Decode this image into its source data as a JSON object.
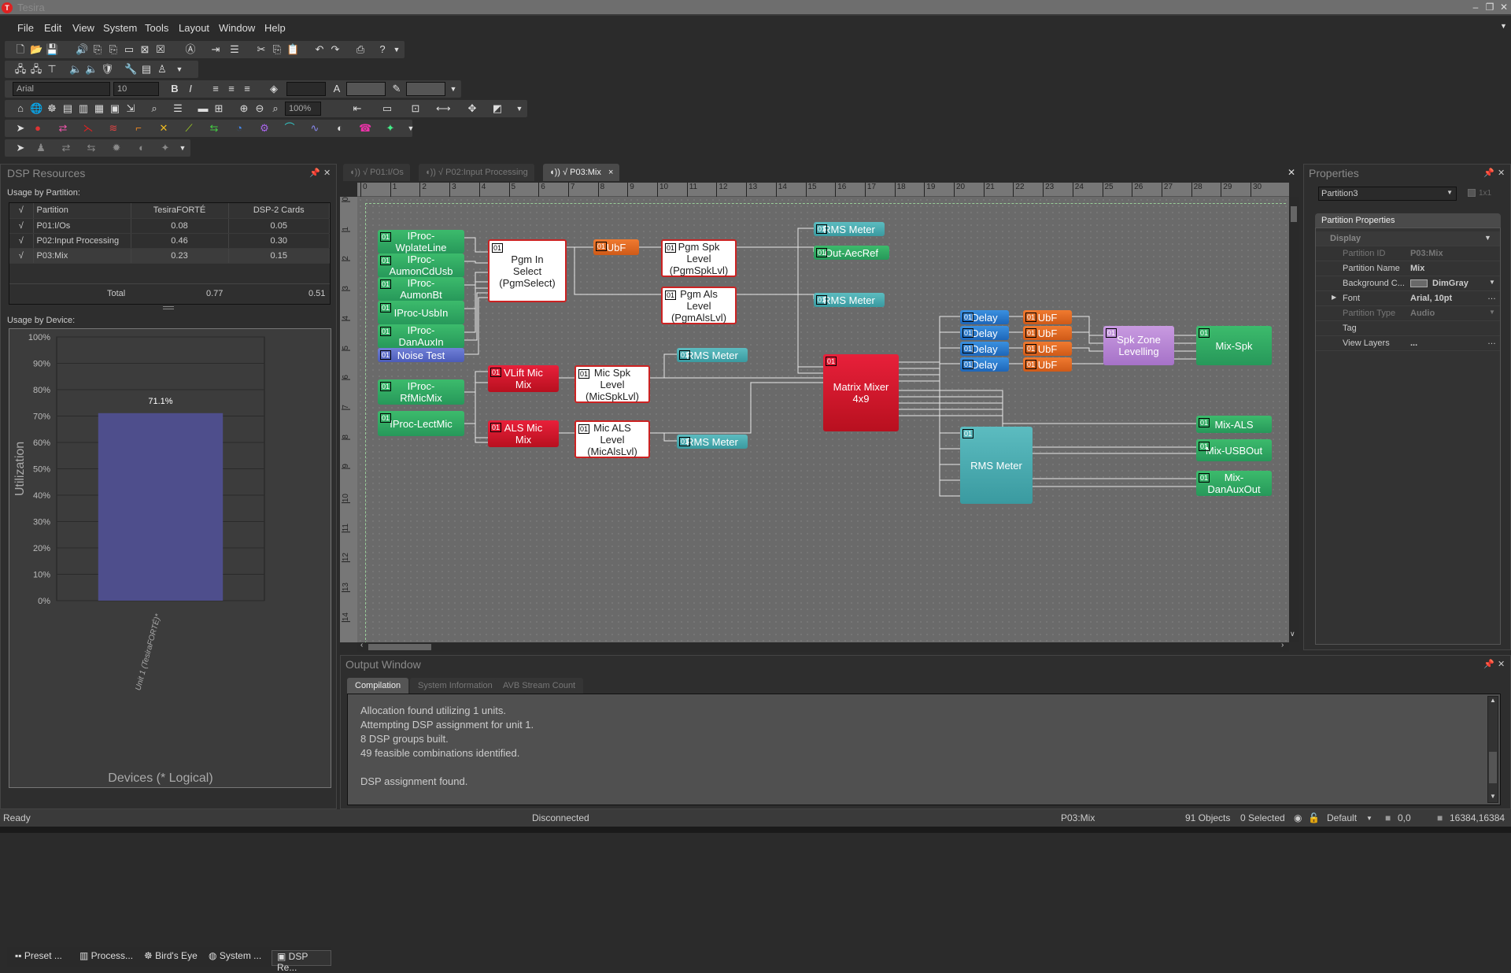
{
  "window": {
    "title": "Tesira",
    "logo": "T"
  },
  "menu": [
    "File",
    "Edit",
    "View",
    "System",
    "Tools",
    "Layout",
    "Window",
    "Help"
  ],
  "toolbar": {
    "font_name": "Arial",
    "font_size": "10",
    "zoom": "100%"
  },
  "dsp_resources": {
    "title": "DSP Resources",
    "usage_by_partition_label": "Usage by Partition:",
    "columns": [
      "√",
      "Partition",
      "TesiraFORTÉ",
      "DSP-2 Cards"
    ],
    "rows": [
      {
        "check": "√",
        "partition": "P01:I/Os",
        "forte": "0.08",
        "dsp2": "0.05"
      },
      {
        "check": "√",
        "partition": "P02:Input Processing",
        "forte": "0.46",
        "dsp2": "0.30"
      },
      {
        "check": "√",
        "partition": "P03:Mix",
        "forte": "0.23",
        "dsp2": "0.15"
      }
    ],
    "total_label": "Total",
    "total_forte": "0.77",
    "total_dsp2": "0.51",
    "usage_by_device_label": "Usage by Device:"
  },
  "chart_data": {
    "type": "bar",
    "categories": [
      "Unit 1 (TesiraFORTÉ)*"
    ],
    "values": [
      71.1
    ],
    "data_labels": [
      "71.1%"
    ],
    "title": "",
    "xlabel": "Devices (* Logical)",
    "ylabel": "Utilization",
    "ylim": [
      0,
      100
    ],
    "yticks": [
      "0%",
      "10%",
      "20%",
      "30%",
      "40%",
      "50%",
      "60%",
      "70%",
      "80%",
      "90%",
      "100%"
    ],
    "grid": true,
    "bar_color": "#4e4e8c"
  },
  "left_tabs": [
    "Preset ...",
    "Process...",
    "Bird's Eye",
    "System ...",
    "DSP Re..."
  ],
  "doc_tabs": [
    {
      "label": "√ P01:I/Os",
      "active": false
    },
    {
      "label": "√ P02:Input Processing",
      "active": false
    },
    {
      "label": "√ P03:Mix",
      "active": true
    }
  ],
  "ruler_h": [
    "0",
    "1",
    "2",
    "3",
    "4",
    "5",
    "6",
    "7",
    "8",
    "9",
    "10",
    "11",
    "12",
    "13",
    "14",
    "15",
    "16",
    "17",
    "18",
    "19",
    "20",
    "21",
    "22",
    "23",
    "24",
    "25",
    "26",
    "27",
    "28",
    "29",
    "30"
  ],
  "ruler_v": [
    "0",
    "1",
    "2",
    "3",
    "4",
    "5",
    "6",
    "7",
    "8",
    "9",
    "10",
    "11",
    "12",
    "13",
    "14"
  ],
  "blocks": {
    "badge": "01",
    "wplate": "IProc-\nWplateLine",
    "aumoncd": "IProc-\nAumonCdUsb",
    "aumonbt": "IProc-\nAumonBt",
    "usbin": "IProc-UsbIn",
    "danaux": "IProc-\nDanAuxIn",
    "noise": "Noise Test",
    "rfmic": "IProc-\nRfMicMix",
    "lectmic": "IProc-LectMic",
    "pgmsel": "Pgm In\nSelect\n(PgmSelect)",
    "ubf": "UbF",
    "pgmspk": "Pgm Spk\nLevel\n(PgmSpkLvl)",
    "pgmals": "Pgm Als\nLevel\n(PgmAlsLvl)",
    "rms": "RMS Meter",
    "aecref": "Out-AecRef",
    "vlift": "VLift Mic\nMix",
    "alsmix": "ALS Mic\nMix",
    "micspk": "Mic Spk\nLevel\n(MicSpkLvl)",
    "micals": "Mic ALS\nLevel\n(MicAlsLvl)",
    "matrix": "Matrix Mixer\n4x9",
    "delay": "Delay",
    "spkzone": "Spk Zone\nLevelling",
    "mixspk": "Mix-Spk",
    "mixals": "Mix-ALS",
    "mixusb": "Mix-USBOut",
    "mixdan": "Mix-\nDanAuxOut"
  },
  "properties": {
    "title": "Properties",
    "selector": "Partition3",
    "grid_label": "1x1",
    "section": "Partition Properties",
    "category": "Display",
    "rows": [
      {
        "key": "Partition ID",
        "value": "P03:Mix",
        "disabled": true
      },
      {
        "key": "Partition Name",
        "value": "Mix",
        "disabled": false
      },
      {
        "key": "Background C...",
        "value": "DimGray",
        "disabled": false
      },
      {
        "key": "Font",
        "value": "Arial, 10pt",
        "disabled": false
      },
      {
        "key": "Partition Type",
        "value": "Audio",
        "disabled": true
      },
      {
        "key": "Tag",
        "value": "",
        "disabled": false
      },
      {
        "key": "View Layers",
        "value": "...",
        "disabled": false
      }
    ]
  },
  "output_window": {
    "title": "Output Window",
    "tabs": [
      "Compilation",
      "System Information",
      "AVB Stream Count"
    ],
    "lines": [
      "Allocation found utilizing 1 units.",
      "Attempting DSP assignment for unit 1.",
      "8 DSP groups built.",
      "49 feasible combinations identified.",
      "",
      "DSP assignment found."
    ]
  },
  "status": {
    "ready": "Ready",
    "connection": "Disconnected",
    "partition": "P03:Mix",
    "objects": "91 Objects",
    "selected": "0 Selected",
    "layer": "Default",
    "pos": "0,0",
    "size": "16384,16384"
  }
}
